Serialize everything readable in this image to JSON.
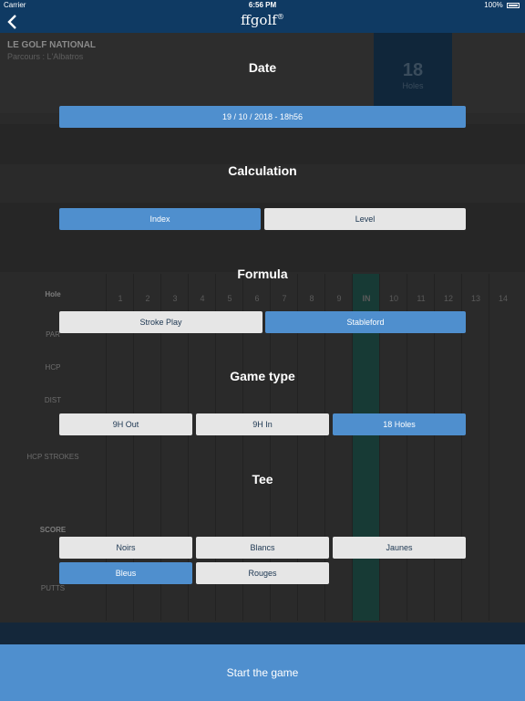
{
  "status": {
    "carrier": "Carrier",
    "time": "6:56 PM",
    "battery": "100%"
  },
  "nav": {
    "back_icon": "chevron-left-icon",
    "brand": "ffgolf",
    "brand_mark": "®"
  },
  "scorecard": {
    "course_name": "LE GOLF NATIONAL",
    "parcours": "Parcours : L'Albatros",
    "holes_count": "18",
    "holes_label": "Holes",
    "row_labels": [
      "Hole",
      "PAR",
      "HCP",
      "DIST",
      "HCP STROKES",
      "SCORE",
      "PUTTS"
    ],
    "columns": [
      "1",
      "2",
      "3",
      "4",
      "5",
      "6",
      "7",
      "8",
      "9",
      "IN",
      "10",
      "11",
      "12",
      "13",
      "14"
    ]
  },
  "date": {
    "title": "Date",
    "value": "19 / 10 / 2018 - 18h56"
  },
  "calculation": {
    "title": "Calculation",
    "options": [
      "Index",
      "Level"
    ],
    "selected": "Index"
  },
  "formula": {
    "title": "Formula",
    "options": [
      "Stroke Play",
      "Stableford"
    ],
    "selected": "Stableford"
  },
  "game_type": {
    "title": "Game type",
    "options": [
      "9H Out",
      "9H In",
      "18 Holes"
    ],
    "selected": "18 Holes"
  },
  "tee": {
    "title": "Tee",
    "options": [
      "Noirs",
      "Blancs",
      "Jaunes",
      "Bleus",
      "Rouges"
    ],
    "selected": "Bleus"
  },
  "start_button": "Start the game",
  "colors": {
    "nav": "#0f3a63",
    "accent": "#4f8fce",
    "option_bg": "#e6e6e6",
    "option_text": "#1b3550"
  }
}
